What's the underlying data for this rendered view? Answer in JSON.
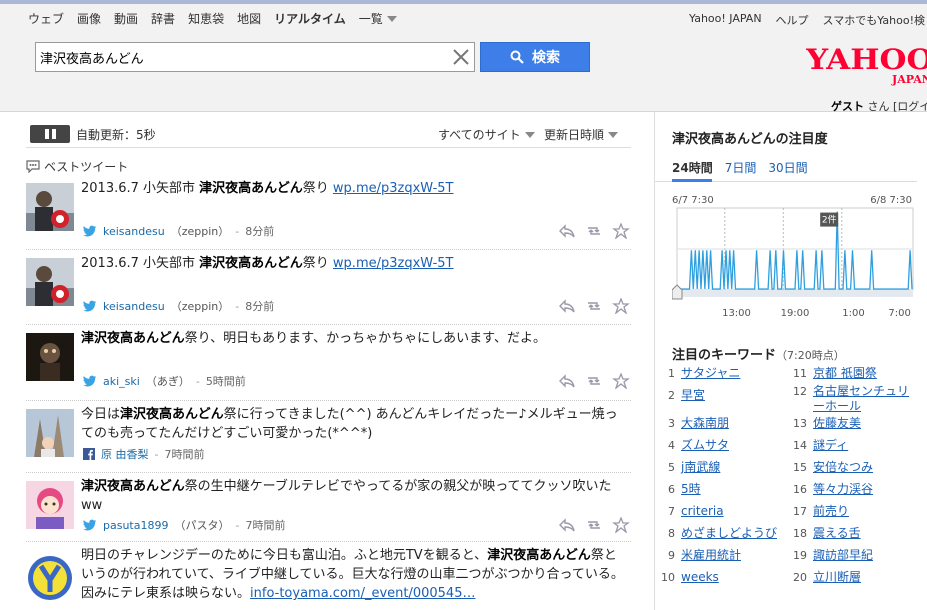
{
  "nav": {
    "tabs": [
      "ウェブ",
      "画像",
      "動画",
      "辞書",
      "知恵袋",
      "地図",
      "リアルタイム"
    ],
    "active_tab": "リアルタイム",
    "more_label": "一覧"
  },
  "util_links": [
    "Yahoo! JAPAN",
    "ヘルプ",
    "スマホでもYahoo!検"
  ],
  "search": {
    "query": "津沢夜高あんどん",
    "button_label": "検索"
  },
  "logo": {
    "text": "YAHOO",
    "sub": "JAPAN"
  },
  "user": {
    "name": "ゲスト",
    "suffix": "さん",
    "login": "[ログイ"
  },
  "toolbar": {
    "auto_refresh": "自動更新：5秒",
    "filter_sites": "すべてのサイト",
    "sort_order": "更新日時順"
  },
  "best_tweet_label": "ベストツイート",
  "tweets": [
    {
      "pre": "2013.6.7 小矢部市 ",
      "bold": "津沢夜高あんどん",
      "post": "祭り ",
      "link": "wp.me/p3zqxW-5T",
      "user": "keisandesu",
      "display": "（zeppin）",
      "time": "8分前",
      "source": "twitter"
    },
    {
      "pre": "2013.6.7 小矢部市 ",
      "bold": "津沢夜高あんどん",
      "post": "祭り ",
      "link": "wp.me/p3zqxW-5T",
      "user": "keisandesu",
      "display": "（zeppin）",
      "time": "8分前",
      "source": "twitter"
    },
    {
      "pre": "",
      "bold": "津沢夜高あんどん",
      "post": "祭り、明日もあります、かっちゃかちゃにしあいます、だよ。",
      "link": "",
      "user": "aki_ski",
      "display": "（あぎ）",
      "time": "5時間前",
      "source": "twitter"
    },
    {
      "pre": "今日は",
      "bold": "津沢夜高あんどん",
      "post": "祭に行ってきました(^^) あんどんキレイだったー♪メルギュー焼ってのも売ってたんだけどすごい可愛かった(*^^*)",
      "link": "",
      "user": "原 由香梨",
      "display": "",
      "time": "7時間前",
      "source": "facebook"
    },
    {
      "pre": "",
      "bold": "津沢夜高あんどん",
      "post": "祭の生中継ケーブルテレビでやってるが家の親父が映っててクッソ吹いたww",
      "link": "",
      "user": "pasuta1899",
      "display": "（パスタ）",
      "time": "7時間前",
      "source": "twitter"
    },
    {
      "pre": "明日のチャレンジデーのために今日も富山泊。ふと地元TVを観ると、",
      "bold": "津沢夜高あんどん",
      "post": "祭というのが行われていて、ライブ中継している。巨大な行燈の山車二つがぶつかり合っている。因みにテレ東系は映らない。",
      "link": "info-toyama.com/_event/000545…",
      "user": "",
      "display": "",
      "time": "",
      "source": ""
    }
  ],
  "trend": {
    "title": "津沢夜高あんどんの注目度",
    "tabs": [
      "24時間",
      "7日間",
      "30日間"
    ],
    "active_tab": "24時間",
    "start_label": "6/7 7:30",
    "end_label": "6/8 7:30",
    "peak_label": "2件",
    "x_ticks": [
      "13:00",
      "19:00",
      "1:00",
      "7:00"
    ]
  },
  "chart_data": {
    "type": "line",
    "title": "",
    "xlabel": "",
    "ylabel": "",
    "x_ticks": [
      "13:00",
      "19:00",
      "1:00",
      "7:00"
    ],
    "ylim": [
      0,
      2
    ],
    "series": [
      {
        "values": [
          0,
          0,
          0,
          0,
          0,
          0,
          0,
          1,
          0,
          1,
          0,
          1,
          0,
          1,
          0,
          1,
          0,
          1,
          0,
          0,
          0,
          0,
          0,
          1,
          0,
          1,
          0,
          1,
          0,
          1,
          0,
          0,
          0,
          0,
          0,
          0,
          0,
          0,
          0,
          0,
          0,
          1,
          0,
          0,
          0,
          0,
          0,
          0,
          1,
          0,
          0,
          1,
          0,
          0,
          0,
          1,
          0,
          0,
          0,
          0,
          0,
          0,
          1,
          0,
          0,
          1,
          0,
          0,
          0,
          0,
          0,
          0,
          1,
          0,
          0,
          1,
          0,
          0,
          0,
          0,
          0,
          0,
          0,
          2,
          0,
          0,
          0,
          1,
          0,
          0,
          0,
          1,
          0,
          0,
          0,
          0,
          0,
          0,
          0,
          0,
          0,
          1,
          0,
          0,
          0,
          0,
          0,
          0,
          0,
          0,
          0,
          0,
          0,
          0,
          0,
          0,
          0,
          0,
          0,
          0,
          0,
          1,
          0
        ]
      }
    ]
  },
  "keywords": {
    "title": "注目のキーワード",
    "time": "（7:20時点）",
    "items": [
      {
        "rank": "1",
        "text": "サタジャニ"
      },
      {
        "rank": "2",
        "text": "早宮"
      },
      {
        "rank": "3",
        "text": "大森南朋"
      },
      {
        "rank": "4",
        "text": "ズムサタ"
      },
      {
        "rank": "5",
        "text": "j南武線"
      },
      {
        "rank": "6",
        "text": "5時"
      },
      {
        "rank": "7",
        "text": "criteria"
      },
      {
        "rank": "8",
        "text": "めざましどようび"
      },
      {
        "rank": "9",
        "text": "米雇用統計"
      },
      {
        "rank": "10",
        "text": "weeks"
      },
      {
        "rank": "11",
        "text": "京都 祇園祭"
      },
      {
        "rank": "12",
        "text": "名古屋センチュリーホール"
      },
      {
        "rank": "13",
        "text": "佐藤友美"
      },
      {
        "rank": "14",
        "text": "謎ディ"
      },
      {
        "rank": "15",
        "text": "安倍なつみ"
      },
      {
        "rank": "16",
        "text": "等々力渓谷"
      },
      {
        "rank": "17",
        "text": "前売り"
      },
      {
        "rank": "18",
        "text": "震える舌"
      },
      {
        "rank": "19",
        "text": "諏訪部早紀"
      },
      {
        "rank": "20",
        "text": "立川断層"
      }
    ]
  },
  "colors": {
    "accent": "#3d7ee8",
    "logo": "#ff0033",
    "link": "#1a5fb4",
    "chart_line": "#2ea0e0"
  }
}
